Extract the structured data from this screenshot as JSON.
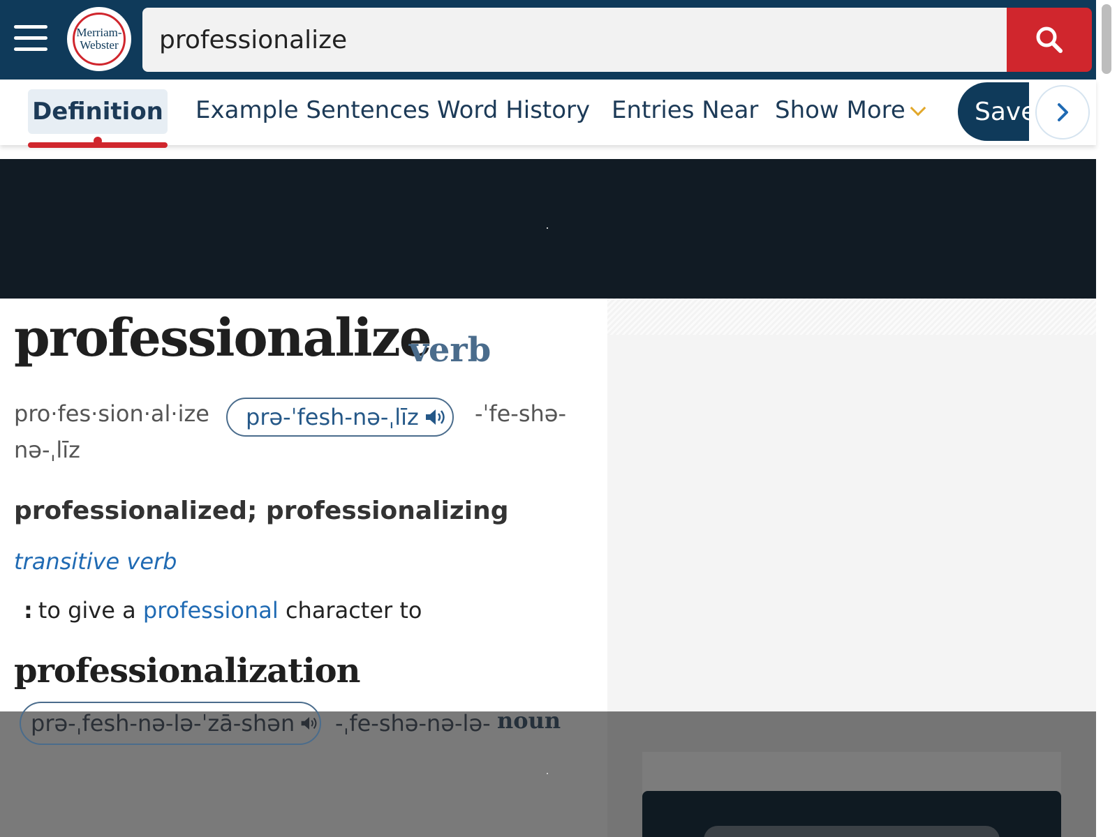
{
  "header": {
    "logo_line1": "Merriam-",
    "logo_line2": "Webster",
    "search_value": "professionalize"
  },
  "tabs": {
    "active": "Definition",
    "items": [
      "Example Sentences",
      "Word History",
      "Entries Near",
      "Show More"
    ],
    "save_label": "Save"
  },
  "entry": {
    "headword": "professionalize",
    "part_of_speech": "verb",
    "syllabification": "pro·fes·sion·al·ize",
    "pronunciation": "prə-ˈfesh-nə-ˌlīz",
    "alt_pronunciation_part1": "-ˈfe-shə-",
    "alt_pronunciation_part2": "nə-ˌlīz",
    "inflections": "professionalized; professionalizing",
    "verb_label": "transitive verb",
    "definition_pre": "to give a",
    "definition_link": "professional",
    "definition_post": "character to"
  },
  "runon": {
    "word": "professionalization",
    "pronunciation": "prə-ˌfesh-nə-lə-ˈzā-shən",
    "alt_pronunciation": "-ˌfe-shə-nə-lə-",
    "part_of_speech": "noun"
  },
  "colors": {
    "brand_navy": "#0f3a5a",
    "brand_red": "#d0262d",
    "link_blue": "#1f6ab3",
    "accent_gold": "#e2a82b"
  }
}
